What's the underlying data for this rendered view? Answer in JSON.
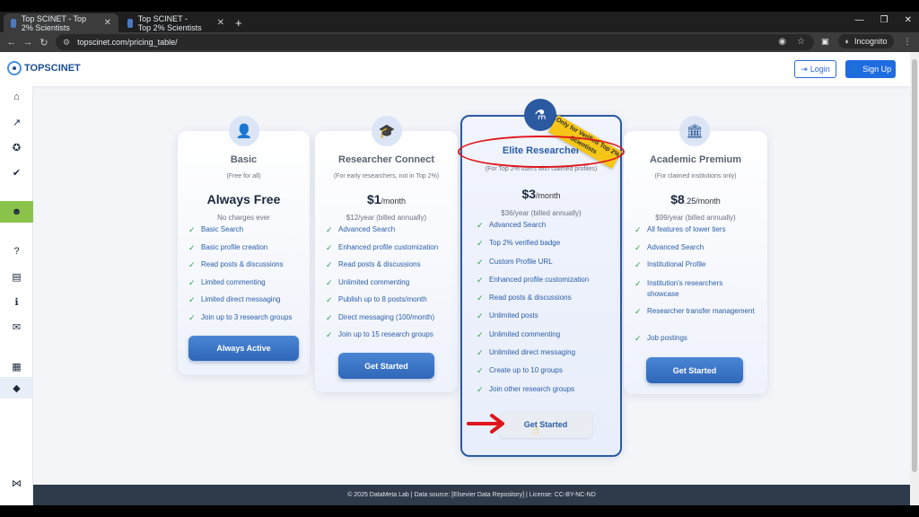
{
  "browser": {
    "tabs": [
      {
        "title": "Top SCINET - Top 2% Scientists",
        "active": true
      },
      {
        "title": "Top SCINET - Top 2% Scientists",
        "active": false
      }
    ],
    "new_tab": "+",
    "url": "topscinet.com/pricing_table/",
    "incognito_label": "Incognito"
  },
  "header": {
    "logo_text": "TOPSCINET",
    "login_label": "Login",
    "signup_label": "Sign Up"
  },
  "sidebar": {
    "items": [
      "home-icon",
      "chart-icon",
      "award-icon",
      "user-check-icon",
      "users-icon",
      "question-icon",
      "ad-icon",
      "info-icon",
      "mail-icon",
      "briefcase-icon",
      "tags-icon",
      "share-icon"
    ]
  },
  "plans": [
    {
      "title": "Basic",
      "subtitle": "(Free for all)",
      "price": "Always Free",
      "note": "No charges ever",
      "features": [
        "Basic Search",
        "Basic profile creation",
        "Read posts & discussions",
        "Limited commenting",
        "Limited direct messaging",
        "Join up to 3 research groups"
      ],
      "cta": "Always Active"
    },
    {
      "title": "Researcher Connect",
      "subtitle": "(For early researchers, not in Top 2%)",
      "price": "$1",
      "unit": "/month",
      "note": "$12/year (billed annually)",
      "features": [
        "Advanced Search",
        "Enhanced profile customization",
        "Read posts & discussions",
        "Unlimited commenting",
        "Publish up to 8 posts/month",
        "Direct messaging (100/month)",
        "Join up to 15 research groups"
      ],
      "cta": "Get Started"
    },
    {
      "title": "Elite Researcher",
      "subtitle": "(For Top 2% users with claimed profiles)",
      "price": "$3",
      "unit": "/month",
      "note": "$36/year (billed annually)",
      "features": [
        "Advanced Search",
        "Top 2% verified badge",
        "Custom Profile URL",
        "Enhanced profile customization",
        "Read posts & discussions",
        "Unlimited posts",
        "Unlimited commenting",
        "Unlimited direct messaging",
        "Create up to 10 groups",
        "Join other research groups"
      ],
      "cta": "Get Started",
      "ribbon": "Only for Verified Top 2% Scientists"
    },
    {
      "title": "Academic Premium",
      "subtitle": "(For claimed institutions only)",
      "price": "$8",
      "price_cents": ".25",
      "unit": "/month",
      "note": "$99/year (billed annually)",
      "features": [
        "All features of lower tiers",
        "Advanced Search",
        "Institutional Profile",
        "Institution's researchers showcase",
        "Researcher transfer management",
        "Job postings"
      ],
      "cta": "Get Started"
    }
  ],
  "footer": {
    "text": "© 2025 DataMeta Lab | Data source: [Elsevier Data Repository] | License: CC-BY-NC-ND"
  },
  "colors": {
    "accent": "#1f6ce0",
    "active_sidebar": "#8bc34a",
    "annotation": "#e0151b",
    "ribbon": "#f5c518"
  }
}
